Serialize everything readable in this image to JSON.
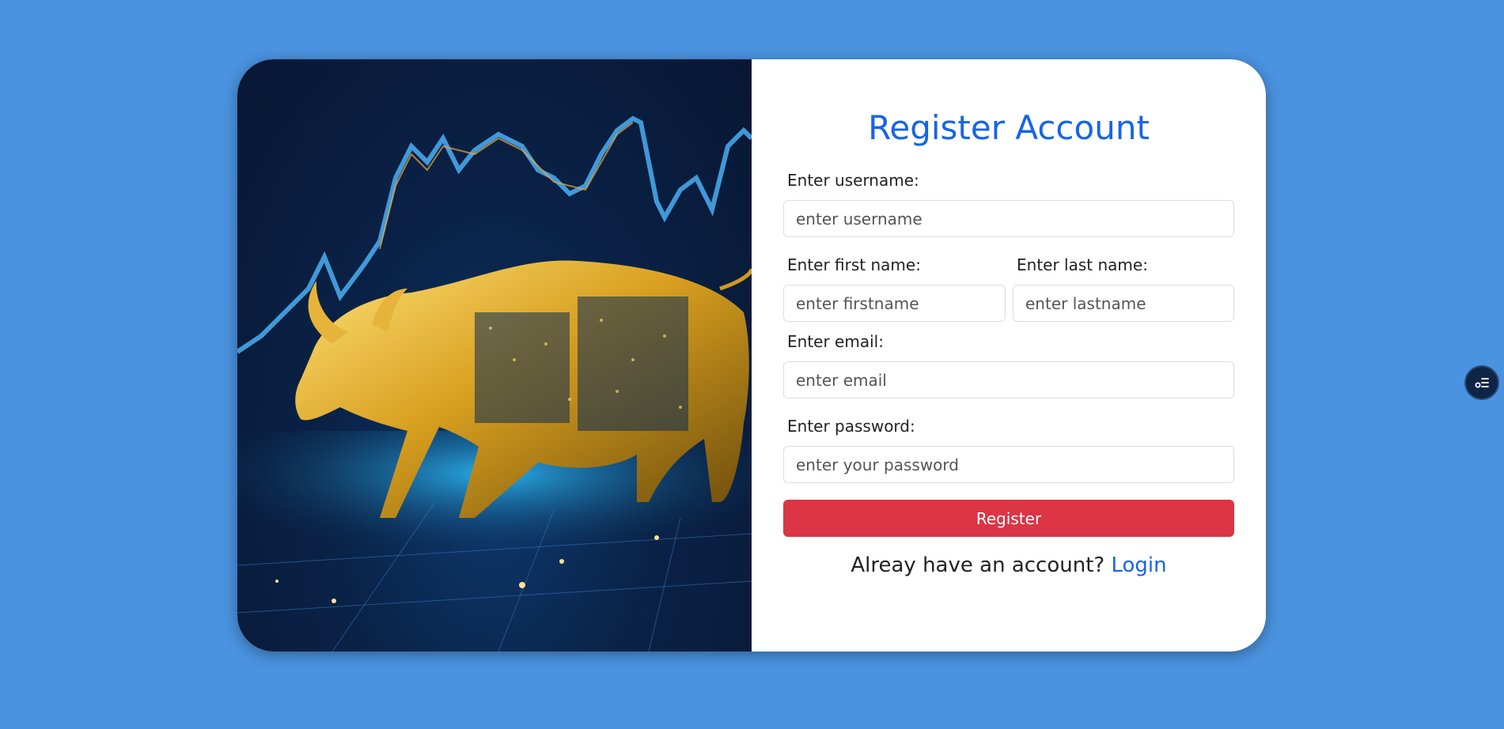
{
  "form": {
    "title": "Register Account",
    "username_label": "Enter username:",
    "username_placeholder": "enter username",
    "firstname_label": "Enter first name:",
    "firstname_placeholder": "enter firstname",
    "lastname_label": "Enter last name:",
    "lastname_placeholder": "enter lastname",
    "email_label": "Enter email:",
    "email_placeholder": "enter email",
    "password_label": "Enter password:",
    "password_placeholder": "enter your password",
    "register_label": "Register",
    "login_prompt": "Alreay have an account?",
    "login_link": "Login"
  },
  "colors": {
    "background": "#4a93e0",
    "accent": "#1565e8",
    "register_button": "#dc3545"
  },
  "icons": {
    "hero": "golden-bull-stock-chart-image",
    "floating": "settings-list-icon"
  }
}
